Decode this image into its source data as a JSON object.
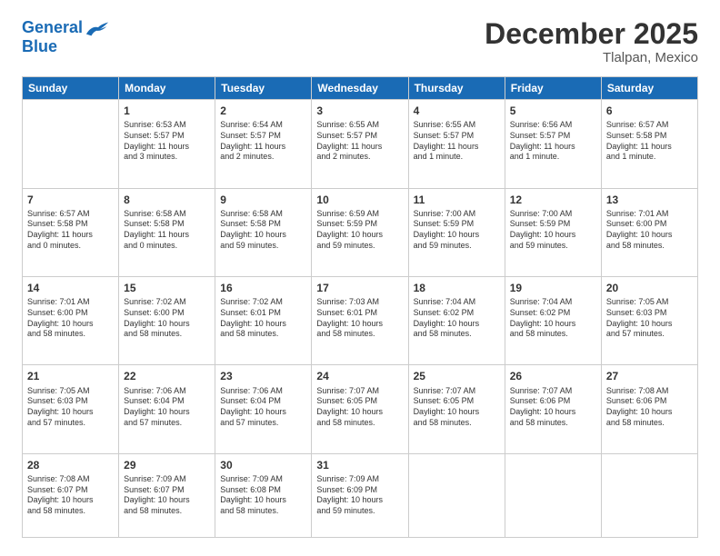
{
  "logo": {
    "line1": "General",
    "line2": "Blue"
  },
  "header": {
    "month": "December 2025",
    "location": "Tlalpan, Mexico"
  },
  "weekdays": [
    "Sunday",
    "Monday",
    "Tuesday",
    "Wednesday",
    "Thursday",
    "Friday",
    "Saturday"
  ],
  "weeks": [
    [
      {
        "day": "",
        "info": ""
      },
      {
        "day": "1",
        "info": "Sunrise: 6:53 AM\nSunset: 5:57 PM\nDaylight: 11 hours\nand 3 minutes."
      },
      {
        "day": "2",
        "info": "Sunrise: 6:54 AM\nSunset: 5:57 PM\nDaylight: 11 hours\nand 2 minutes."
      },
      {
        "day": "3",
        "info": "Sunrise: 6:55 AM\nSunset: 5:57 PM\nDaylight: 11 hours\nand 2 minutes."
      },
      {
        "day": "4",
        "info": "Sunrise: 6:55 AM\nSunset: 5:57 PM\nDaylight: 11 hours\nand 1 minute."
      },
      {
        "day": "5",
        "info": "Sunrise: 6:56 AM\nSunset: 5:57 PM\nDaylight: 11 hours\nand 1 minute."
      },
      {
        "day": "6",
        "info": "Sunrise: 6:57 AM\nSunset: 5:58 PM\nDaylight: 11 hours\nand 1 minute."
      }
    ],
    [
      {
        "day": "7",
        "info": "Sunrise: 6:57 AM\nSunset: 5:58 PM\nDaylight: 11 hours\nand 0 minutes."
      },
      {
        "day": "8",
        "info": "Sunrise: 6:58 AM\nSunset: 5:58 PM\nDaylight: 11 hours\nand 0 minutes."
      },
      {
        "day": "9",
        "info": "Sunrise: 6:58 AM\nSunset: 5:58 PM\nDaylight: 10 hours\nand 59 minutes."
      },
      {
        "day": "10",
        "info": "Sunrise: 6:59 AM\nSunset: 5:59 PM\nDaylight: 10 hours\nand 59 minutes."
      },
      {
        "day": "11",
        "info": "Sunrise: 7:00 AM\nSunset: 5:59 PM\nDaylight: 10 hours\nand 59 minutes."
      },
      {
        "day": "12",
        "info": "Sunrise: 7:00 AM\nSunset: 5:59 PM\nDaylight: 10 hours\nand 59 minutes."
      },
      {
        "day": "13",
        "info": "Sunrise: 7:01 AM\nSunset: 6:00 PM\nDaylight: 10 hours\nand 58 minutes."
      }
    ],
    [
      {
        "day": "14",
        "info": "Sunrise: 7:01 AM\nSunset: 6:00 PM\nDaylight: 10 hours\nand 58 minutes."
      },
      {
        "day": "15",
        "info": "Sunrise: 7:02 AM\nSunset: 6:00 PM\nDaylight: 10 hours\nand 58 minutes."
      },
      {
        "day": "16",
        "info": "Sunrise: 7:02 AM\nSunset: 6:01 PM\nDaylight: 10 hours\nand 58 minutes."
      },
      {
        "day": "17",
        "info": "Sunrise: 7:03 AM\nSunset: 6:01 PM\nDaylight: 10 hours\nand 58 minutes."
      },
      {
        "day": "18",
        "info": "Sunrise: 7:04 AM\nSunset: 6:02 PM\nDaylight: 10 hours\nand 58 minutes."
      },
      {
        "day": "19",
        "info": "Sunrise: 7:04 AM\nSunset: 6:02 PM\nDaylight: 10 hours\nand 58 minutes."
      },
      {
        "day": "20",
        "info": "Sunrise: 7:05 AM\nSunset: 6:03 PM\nDaylight: 10 hours\nand 57 minutes."
      }
    ],
    [
      {
        "day": "21",
        "info": "Sunrise: 7:05 AM\nSunset: 6:03 PM\nDaylight: 10 hours\nand 57 minutes."
      },
      {
        "day": "22",
        "info": "Sunrise: 7:06 AM\nSunset: 6:04 PM\nDaylight: 10 hours\nand 57 minutes."
      },
      {
        "day": "23",
        "info": "Sunrise: 7:06 AM\nSunset: 6:04 PM\nDaylight: 10 hours\nand 57 minutes."
      },
      {
        "day": "24",
        "info": "Sunrise: 7:07 AM\nSunset: 6:05 PM\nDaylight: 10 hours\nand 58 minutes."
      },
      {
        "day": "25",
        "info": "Sunrise: 7:07 AM\nSunset: 6:05 PM\nDaylight: 10 hours\nand 58 minutes."
      },
      {
        "day": "26",
        "info": "Sunrise: 7:07 AM\nSunset: 6:06 PM\nDaylight: 10 hours\nand 58 minutes."
      },
      {
        "day": "27",
        "info": "Sunrise: 7:08 AM\nSunset: 6:06 PM\nDaylight: 10 hours\nand 58 minutes."
      }
    ],
    [
      {
        "day": "28",
        "info": "Sunrise: 7:08 AM\nSunset: 6:07 PM\nDaylight: 10 hours\nand 58 minutes."
      },
      {
        "day": "29",
        "info": "Sunrise: 7:09 AM\nSunset: 6:07 PM\nDaylight: 10 hours\nand 58 minutes."
      },
      {
        "day": "30",
        "info": "Sunrise: 7:09 AM\nSunset: 6:08 PM\nDaylight: 10 hours\nand 58 minutes."
      },
      {
        "day": "31",
        "info": "Sunrise: 7:09 AM\nSunset: 6:09 PM\nDaylight: 10 hours\nand 59 minutes."
      },
      {
        "day": "",
        "info": ""
      },
      {
        "day": "",
        "info": ""
      },
      {
        "day": "",
        "info": ""
      }
    ]
  ]
}
